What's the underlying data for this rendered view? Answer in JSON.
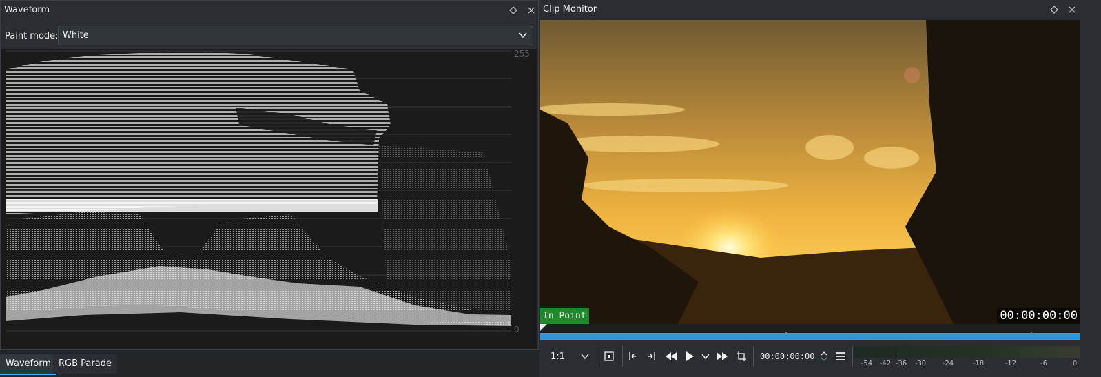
{
  "waveform_panel": {
    "title": "Waveform",
    "paint_mode_label": "Paint mode:",
    "paint_mode_value": "White",
    "scale_top": "255",
    "scale_bottom": "0",
    "tabs": [
      {
        "label": "Waveform",
        "active": true
      },
      {
        "label": "RGB Parade",
        "active": false
      }
    ]
  },
  "clip_monitor": {
    "title": "Clip Monitor",
    "in_point_label": "In Point",
    "overlay_timecode": "00:00:00:00",
    "zoom": "1:1",
    "timecode": "00:00:00:00",
    "audio_meter_labels": [
      "-54",
      "-42",
      "-36",
      "-30",
      "-24",
      "-18",
      "-12",
      "-6",
      "0"
    ]
  },
  "colors": {
    "accent": "#3daee9",
    "timeline": "#3796cf",
    "in_point": "#1e8a2a",
    "panel_bg": "#2a2e32"
  }
}
